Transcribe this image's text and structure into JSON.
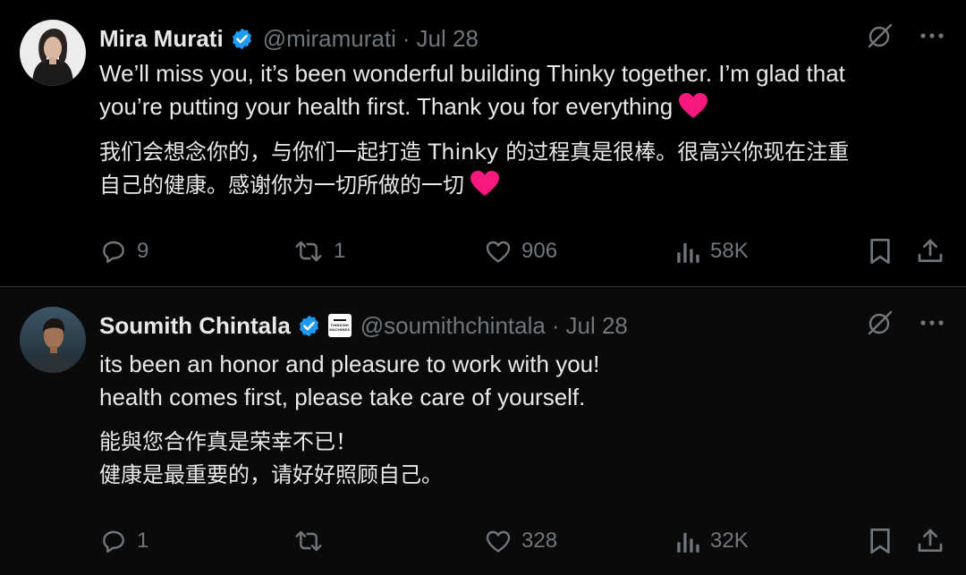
{
  "tweets": [
    {
      "author": {
        "name": "Mira Murati",
        "handle": "@miramurati",
        "date": "Jul 28",
        "verified": true
      },
      "text_en": "We’ll miss you, it’s been wonderful building Thinky together. I’m glad that\nyou’re putting your health first. Thank you for everything",
      "text_zh": "我们会想念你的，与你们一起打造 Thinky 的过程真是很棒。很高兴你现在注重\n自己的健康。感谢你为一切所做的一切",
      "ends_with_heart": true,
      "stats": {
        "replies": "9",
        "reposts": "1",
        "likes": "906",
        "views": "58K"
      }
    },
    {
      "author": {
        "name": "Soumith Chintala",
        "handle": "@soumithchintala",
        "date": "Jul 28",
        "verified": true,
        "affiliation_badge": "THINKING MACHINES"
      },
      "text_en": "its been an honor and pleasure to work with you!\nhealth comes first, please take care of yourself.",
      "text_zh": "能與您合作真是荣幸不已！\n健康是最重要的，请好好照顾自己。",
      "ends_with_heart": false,
      "stats": {
        "replies": "1",
        "reposts": "",
        "likes": "328",
        "views": "32K"
      }
    }
  ],
  "ui": {
    "separator": "·",
    "icons": [
      "grok-icon",
      "more-icon",
      "reply-icon",
      "repost-icon",
      "like-icon",
      "views-icon",
      "bookmark-icon",
      "share-icon",
      "verified-badge-icon",
      "heart-emoji-icon"
    ]
  },
  "colors": {
    "background": "#000000",
    "text_primary": "#e7e9ea",
    "text_secondary": "#71767b",
    "verified_blue": "#1d9bf0",
    "heart_red": "#f91880",
    "divider": "#2f3336"
  }
}
